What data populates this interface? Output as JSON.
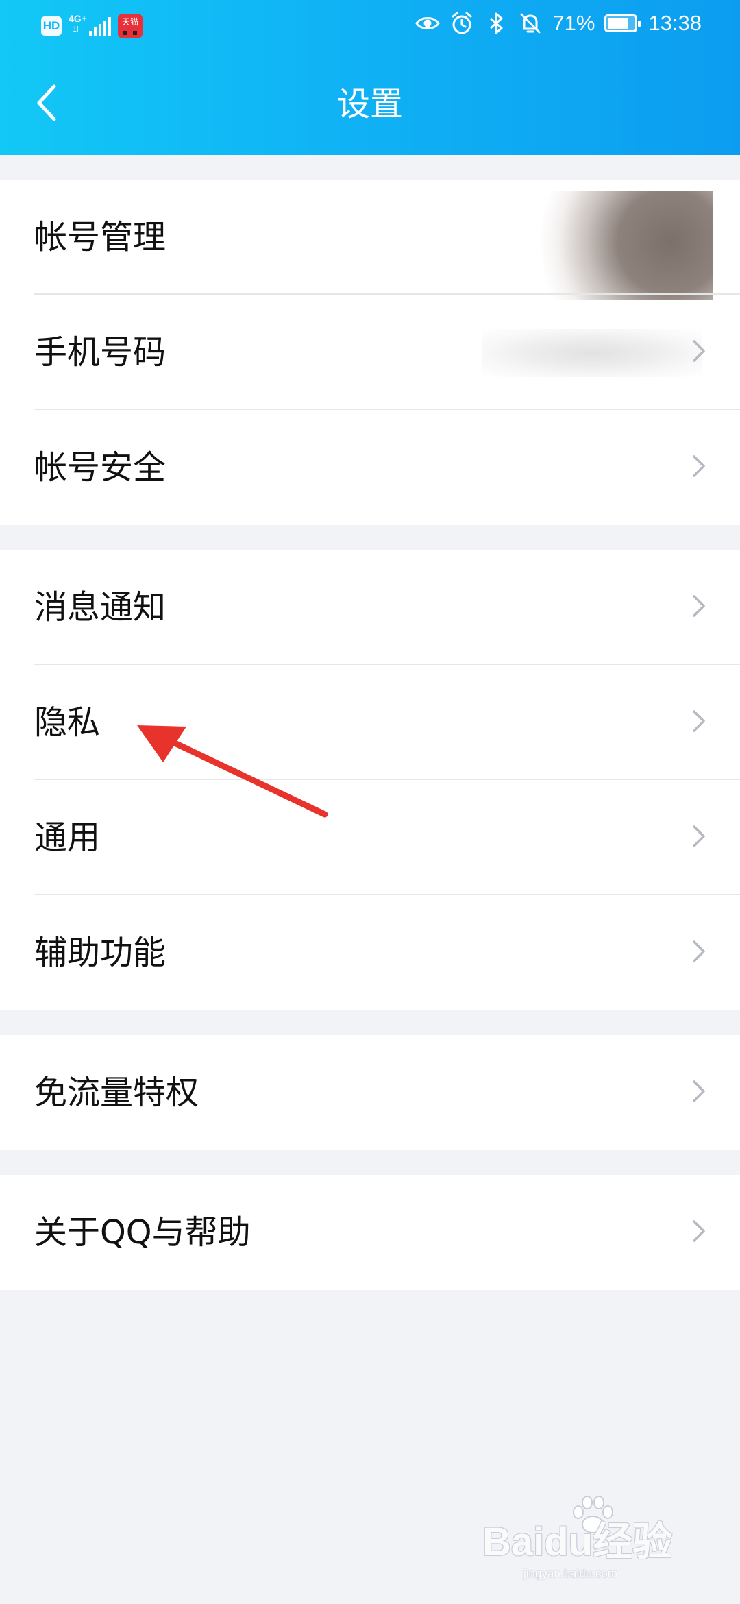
{
  "status_bar": {
    "hd": "HD",
    "network_type": "4G+",
    "network_sub": "1l",
    "app_badge": "天猫",
    "battery_percent": "71%",
    "battery_level": 0.71,
    "time": "13:38"
  },
  "header": {
    "title": "设置",
    "back_icon": "chevron-left-icon"
  },
  "groups": [
    {
      "items": [
        {
          "label": "帐号管理",
          "trailing": "blurred-avatar"
        },
        {
          "label": "手机号码",
          "trailing": "blurred-phone-number"
        },
        {
          "label": "帐号安全"
        }
      ]
    },
    {
      "items": [
        {
          "label": "消息通知"
        },
        {
          "label": "隐私"
        },
        {
          "label": "通用"
        },
        {
          "label": "辅助功能"
        }
      ]
    },
    {
      "items": [
        {
          "label": "免流量特权"
        }
      ]
    },
    {
      "items": [
        {
          "label": "关于QQ与帮助"
        }
      ]
    }
  ],
  "annotation": {
    "type": "red-arrow",
    "target": "隐私",
    "color": "#e8322c"
  },
  "watermark": {
    "text": "Baidu经验",
    "sub": "jingyan.baidu.com"
  },
  "colors": {
    "header_gradient_start": "#12c8f6",
    "header_gradient_end": "#0c9df0",
    "background": "#f1f3f7",
    "row_background": "#ffffff",
    "label_text": "#111111",
    "chevron": "#b6b9c2"
  }
}
